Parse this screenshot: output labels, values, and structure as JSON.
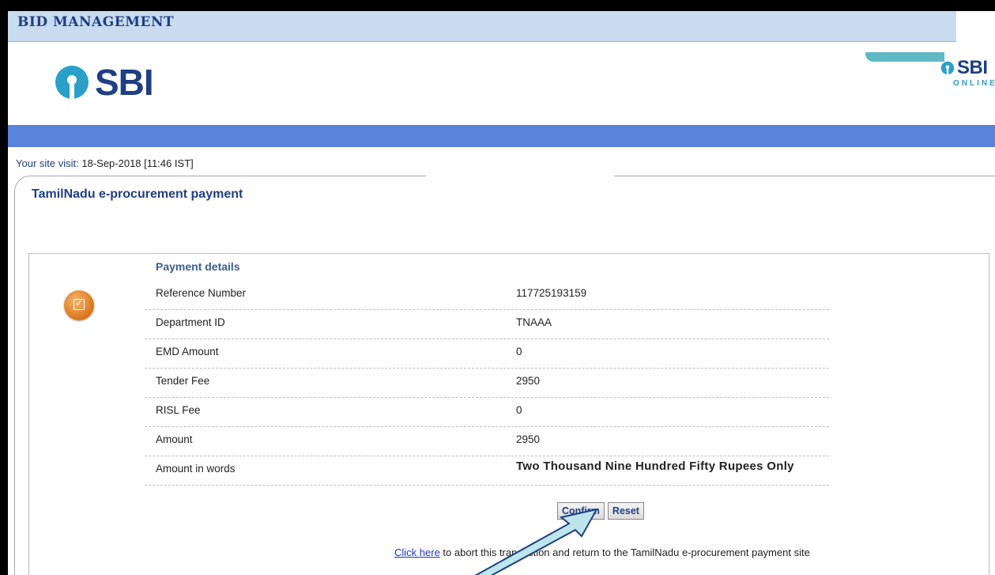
{
  "header": {
    "title": "BID MANAGEMENT"
  },
  "logo": {
    "text": "SBI"
  },
  "right_logo": {
    "text": "SBI",
    "sub": "ONLINE"
  },
  "visit": {
    "label": "Your site visit:",
    "value": "18-Sep-2018 [11:46 IST]"
  },
  "page": {
    "title": "TamilNadu e-procurement payment"
  },
  "details": {
    "heading": "Payment details",
    "rows": [
      {
        "label": "Reference Number",
        "value": "117725193159"
      },
      {
        "label": "Department ID",
        "value": "TNAAA"
      },
      {
        "label": "EMD Amount",
        "value": "0"
      },
      {
        "label": "Tender Fee",
        "value": "2950"
      },
      {
        "label": "RISL Fee",
        "value": "0"
      },
      {
        "label": "Amount",
        "value": "2950"
      },
      {
        "label": "Amount in words",
        "value": "Two Thousand Nine Hundred Fifty Rupees Only"
      }
    ]
  },
  "buttons": {
    "confirm": "Confirm",
    "reset": "Reset"
  },
  "abort": {
    "link": "Click here",
    "text": " to abort this transaction and return to the TamilNadu e-procurement payment site"
  },
  "colors": {
    "brand_blue": "#1e3f83",
    "bar_blue": "#5a83db",
    "accent_teal": "#5fb8c6"
  }
}
